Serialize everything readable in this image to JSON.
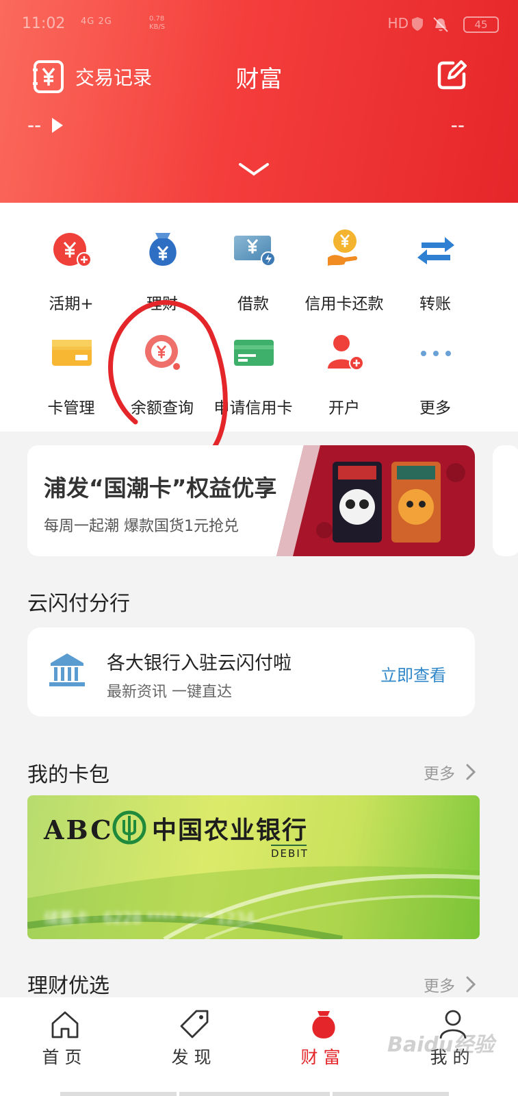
{
  "status_bar": {
    "time": "11:02",
    "network": "4G 2G",
    "speed": "0.78 KB/S",
    "hd": "HD",
    "battery": "45"
  },
  "header": {
    "tx_record_label": "交易记录",
    "title": "财富",
    "balance_left": "--",
    "balance_right": "--"
  },
  "quick_grid": [
    {
      "label": "活期+",
      "icon": "current-plus-icon"
    },
    {
      "label": "理财",
      "icon": "money-bag-icon"
    },
    {
      "label": "借款",
      "icon": "loan-icon"
    },
    {
      "label": "信用卡还款",
      "icon": "credit-repay-icon"
    },
    {
      "label": "转账",
      "icon": "transfer-icon"
    },
    {
      "label": "卡管理",
      "icon": "card-manage-icon"
    },
    {
      "label": "余额查询",
      "icon": "balance-query-icon"
    },
    {
      "label": "申请信用卡",
      "icon": "apply-card-icon"
    },
    {
      "label": "开户",
      "icon": "open-account-icon"
    },
    {
      "label": "更多",
      "icon": "more-icon"
    }
  ],
  "banner": {
    "title": "浦发“国潮卡”权益优享",
    "subtitle": "每周一起潮 爆款国货1元抢兑"
  },
  "unionpay_section": {
    "title": "云闪付分行",
    "card_title": "各大银行入驻云闪付啦",
    "card_subtitle": "最新资讯 一键直达",
    "action": "立即查看"
  },
  "wallet_section": {
    "title": "我的卡包",
    "more": "更多",
    "card": {
      "abc": "ABC",
      "bank_name": "中国农业银行",
      "type": "DEBIT",
      "number_line": "储蓄卡 · 6228 **** **** 1234"
    }
  },
  "wealth_section": {
    "title": "理财优选",
    "more": "更多"
  },
  "bottom_nav": [
    {
      "label": "首页"
    },
    {
      "label": "发现"
    },
    {
      "label": "财富"
    },
    {
      "label": "我的"
    }
  ],
  "watermark": "Baidu经验",
  "colors": {
    "brand_red": "#e4262a",
    "link_blue": "#2f87c9"
  }
}
